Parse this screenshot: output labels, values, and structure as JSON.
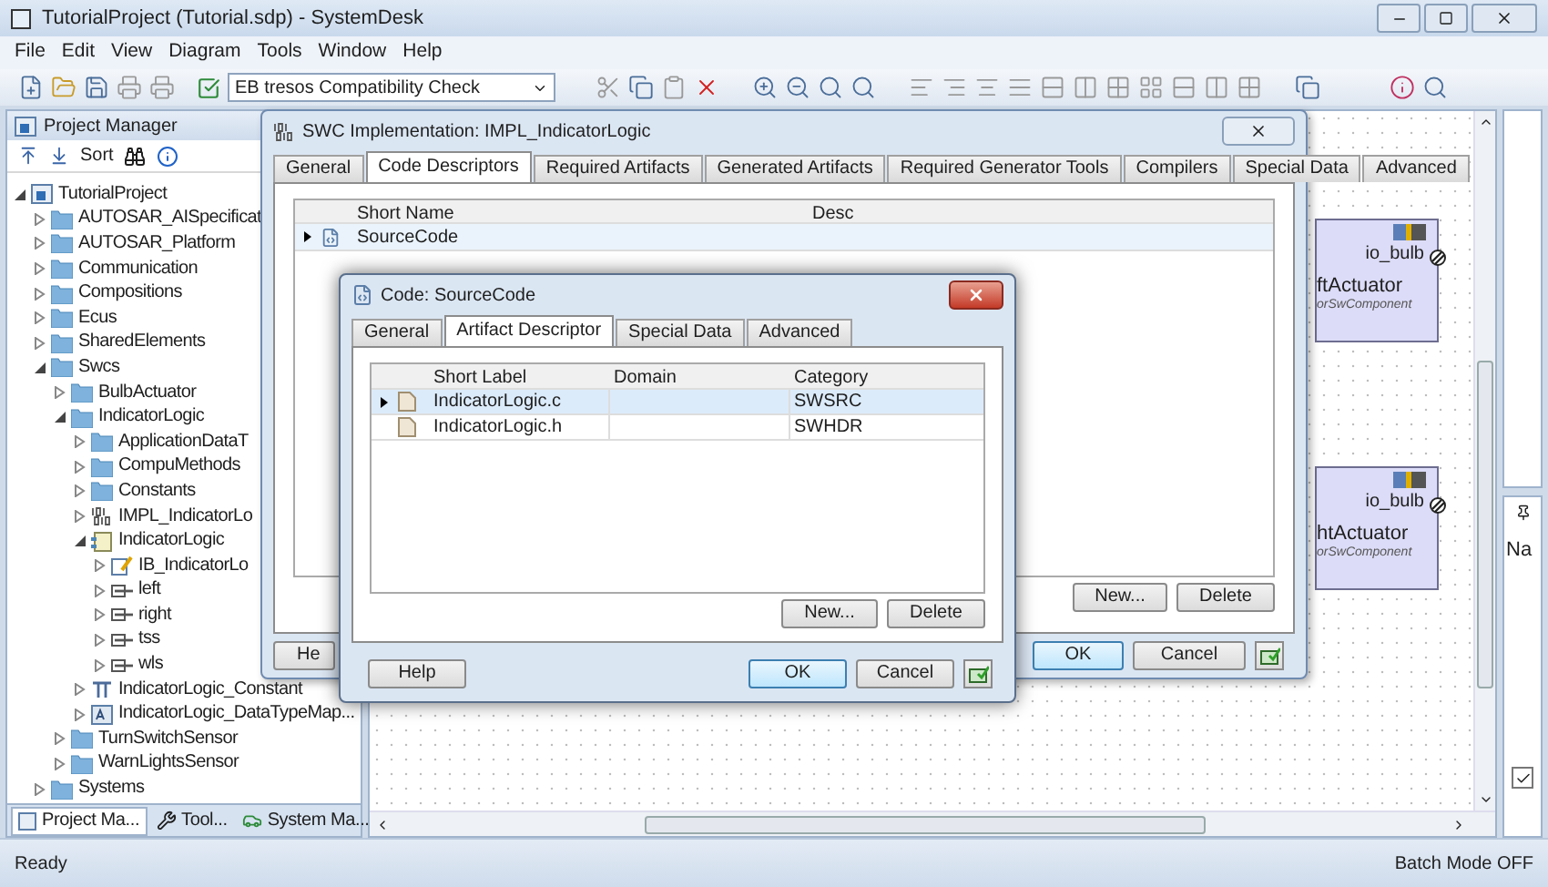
{
  "window": {
    "title": "TutorialProject (Tutorial.sdp) - SystemDesk"
  },
  "menu": [
    "File",
    "Edit",
    "View",
    "Diagram",
    "Tools",
    "Window",
    "Help"
  ],
  "toolbar": {
    "dropdown": "EB tresos Compatibility Check"
  },
  "project_manager": {
    "title": "Project Manager",
    "sort": "Sort",
    "tree": [
      {
        "label": "TutorialProject",
        "kind": "project",
        "expanded": true,
        "children": [
          {
            "label": "AUTOSAR_AISpecificat",
            "kind": "folder",
            "expanded": false
          },
          {
            "label": "AUTOSAR_Platform",
            "kind": "folder",
            "expanded": false
          },
          {
            "label": "Communication",
            "kind": "folder",
            "expanded": false
          },
          {
            "label": "Compositions",
            "kind": "folder",
            "expanded": false
          },
          {
            "label": "Ecus",
            "kind": "folder",
            "expanded": false
          },
          {
            "label": "SharedElements",
            "kind": "folder",
            "expanded": false
          },
          {
            "label": "Swcs",
            "kind": "folder",
            "expanded": true,
            "children": [
              {
                "label": "BulbActuator",
                "kind": "folder",
                "expanded": false
              },
              {
                "label": "IndicatorLogic",
                "kind": "folder",
                "expanded": true,
                "children": [
                  {
                    "label": "ApplicationDataT",
                    "kind": "folder",
                    "expanded": false
                  },
                  {
                    "label": "CompuMethods",
                    "kind": "folder",
                    "expanded": false
                  },
                  {
                    "label": "Constants",
                    "kind": "folder",
                    "expanded": false
                  },
                  {
                    "label": "IMPL_IndicatorLo",
                    "kind": "impl",
                    "expanded": false
                  },
                  {
                    "label": "IndicatorLogic",
                    "kind": "component",
                    "expanded": true,
                    "children": [
                      {
                        "label": "IB_IndicatorLo",
                        "kind": "behavior",
                        "expanded": false
                      },
                      {
                        "label": "left",
                        "kind": "port",
                        "expanded": false
                      },
                      {
                        "label": "right",
                        "kind": "port",
                        "expanded": false
                      },
                      {
                        "label": "tss",
                        "kind": "port",
                        "expanded": false
                      },
                      {
                        "label": "wls",
                        "kind": "port",
                        "expanded": false
                      }
                    ]
                  },
                  {
                    "label": "IndicatorLogic_Constant",
                    "kind": "constspec",
                    "expanded": false
                  },
                  {
                    "label": "IndicatorLogic_DataTypeMap...",
                    "kind": "mapping",
                    "expanded": false
                  }
                ]
              },
              {
                "label": "TurnSwitchSensor",
                "kind": "folder",
                "expanded": false
              },
              {
                "label": "WarnLightsSensor",
                "kind": "folder",
                "expanded": false
              }
            ]
          },
          {
            "label": "Systems",
            "kind": "folder",
            "expanded": false
          }
        ]
      }
    ],
    "tabs": [
      {
        "label": "Project Ma...",
        "kind": "project",
        "selected": true
      },
      {
        "label": "Tool...",
        "kind": "tools",
        "selected": false
      },
      {
        "label": "System Ma...",
        "kind": "car",
        "selected": false
      }
    ]
  },
  "diagram": {
    "components": [
      {
        "name": "ftActuator",
        "port": "io_bulb",
        "type": "orSwComponent"
      },
      {
        "name": "htActuator",
        "port": "io_bulb",
        "type": "orSwComponent"
      }
    ]
  },
  "side_panel": {
    "header": "Na",
    "checked": true
  },
  "swc_dialog": {
    "title": "SWC Implementation: IMPL_IndicatorLogic",
    "tabs": [
      {
        "label": "General",
        "selected": false
      },
      {
        "label": "Code Descriptors",
        "selected": true
      },
      {
        "label": "Required Artifacts",
        "selected": false
      },
      {
        "label": "Generated Artifacts",
        "selected": false
      },
      {
        "label": "Required Generator Tools",
        "selected": false
      },
      {
        "label": "Compilers",
        "selected": false
      },
      {
        "label": "Special Data",
        "selected": false
      },
      {
        "label": "Advanced",
        "selected": false
      }
    ],
    "columns": [
      "Short Name",
      "Desc"
    ],
    "rows": [
      {
        "short_name": "SourceCode",
        "selected": true
      }
    ],
    "list_buttons": [
      "New...",
      "Delete"
    ],
    "footer": {
      "help": "He",
      "ok": "OK",
      "cancel": "Cancel"
    }
  },
  "code_dialog": {
    "title": "Code: SourceCode",
    "tabs": [
      {
        "label": "General",
        "selected": false
      },
      {
        "label": "Artifact Descriptor",
        "selected": true
      },
      {
        "label": "Special Data",
        "selected": false
      },
      {
        "label": "Advanced",
        "selected": false
      }
    ],
    "columns": [
      "Short Label",
      "Domain",
      "Category"
    ],
    "rows": [
      {
        "short_label": "IndicatorLogic.c",
        "category": "SWSRC",
        "selected": true
      },
      {
        "short_label": "IndicatorLogic.h",
        "category": "SWHDR",
        "selected": false
      }
    ],
    "list_buttons": [
      "New...",
      "Delete"
    ],
    "footer": {
      "help": "Help",
      "ok": "OK",
      "cancel": "Cancel"
    }
  },
  "status_bar": {
    "left": "Ready",
    "right": "Batch Mode OFF"
  }
}
